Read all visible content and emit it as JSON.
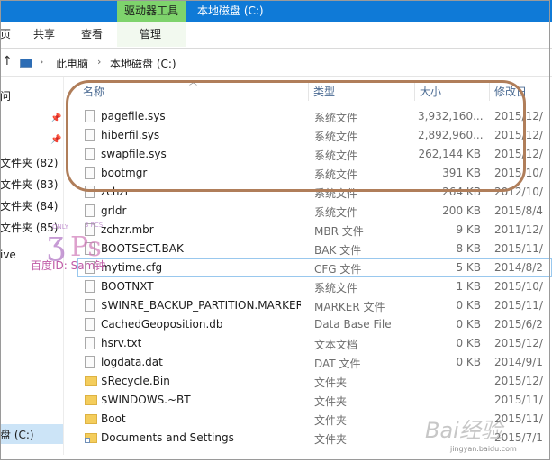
{
  "titlebar": {
    "context_tab": "驱动器工具",
    "title": "本地磁盘 (C:)",
    "bg_color": "#0f7ad7",
    "context_color": "#7ed36c"
  },
  "ribbon": {
    "file_partial": "页",
    "share": "共享",
    "view": "查看",
    "manage": "管理"
  },
  "address": {
    "back_icon": "back-arrow-icon",
    "crumbs": [
      "此电脑",
      "本地磁盘 (C:)"
    ],
    "separator": "›"
  },
  "nav": {
    "items": [
      {
        "label": "问",
        "pinned": false
      },
      {
        "label": "",
        "pinned": true
      },
      {
        "label": "",
        "pinned": true
      },
      {
        "label": "文件夹 (82)",
        "pinned": false
      },
      {
        "label": "文件夹 (83)",
        "pinned": false
      },
      {
        "label": "文件夹 (84)",
        "pinned": false
      },
      {
        "label": "文件夹 (85)",
        "pinned": false
      },
      {
        "label": "ive",
        "pinned": false
      }
    ],
    "selected": "盘 (C:)"
  },
  "columns": {
    "name": "名称",
    "type": "类型",
    "size": "大小",
    "date": "修改日"
  },
  "files": [
    {
      "name": "pagefile.sys",
      "type": "系统文件",
      "size": "3,932,160...",
      "date": "2015/12/",
      "icon": "file"
    },
    {
      "name": "hiberfil.sys",
      "type": "系统文件",
      "size": "2,892,960...",
      "date": "2015/12/",
      "icon": "file"
    },
    {
      "name": "swapfile.sys",
      "type": "系统文件",
      "size": "262,144 KB",
      "date": "2015/12/",
      "icon": "file"
    },
    {
      "name": "bootmgr",
      "type": "系统文件",
      "size": "391 KB",
      "date": "2015/10/",
      "icon": "file"
    },
    {
      "name": "zchzr",
      "type": "系统文件",
      "size": "264 KB",
      "date": "2012/10/",
      "icon": "file"
    },
    {
      "name": "grldr",
      "type": "系统文件",
      "size": "200 KB",
      "date": "2015/8/4",
      "icon": "file"
    },
    {
      "name": "zchzr.mbr",
      "type": "MBR 文件",
      "size": "9 KB",
      "date": "2011/12/",
      "icon": "file"
    },
    {
      "name": "BOOTSECT.BAK",
      "type": "BAK 文件",
      "size": "8 KB",
      "date": "2015/11/",
      "icon": "file"
    },
    {
      "name": "mytime.cfg",
      "type": "CFG 文件",
      "size": "5 KB",
      "date": "2014/8/2",
      "icon": "file"
    },
    {
      "name": "BOOTNXT",
      "type": "系统文件",
      "size": "1 KB",
      "date": "2015/10/",
      "icon": "file"
    },
    {
      "name": "$WINRE_BACKUP_PARTITION.MARKER",
      "type": "MARKER 文件",
      "size": "0 KB",
      "date": "2015/11/",
      "icon": "file"
    },
    {
      "name": "CachedGeoposition.db",
      "type": "Data Base File",
      "size": "0 KB",
      "date": "2015/6/2",
      "icon": "file"
    },
    {
      "name": "hsrv.txt",
      "type": "文本文档",
      "size": "0 KB",
      "date": "2015/12/",
      "icon": "file"
    },
    {
      "name": "logdata.dat",
      "type": "DAT 文件",
      "size": "0 KB",
      "date": "2014/9/1",
      "icon": "file"
    },
    {
      "name": "$Recycle.Bin",
      "type": "文件夹",
      "size": "",
      "date": "2015/12/",
      "icon": "folder"
    },
    {
      "name": "$WINDOWS.~BT",
      "type": "文件夹",
      "size": "",
      "date": "2015/11/",
      "icon": "folder"
    },
    {
      "name": "Boot",
      "type": "文件夹",
      "size": "",
      "date": "2015/11/",
      "icon": "folder"
    },
    {
      "name": "Documents and Settings",
      "type": "文件夹",
      "size": "",
      "date": "2015/7/1",
      "icon": "shortcut"
    }
  ],
  "annotation": {
    "color": "#b07e5a"
  },
  "watermark": {
    "logo_text": "百度ID: Sam钟",
    "baidu_text": "Bai经验",
    "baidu_url": "jingyan.baidu.com"
  }
}
